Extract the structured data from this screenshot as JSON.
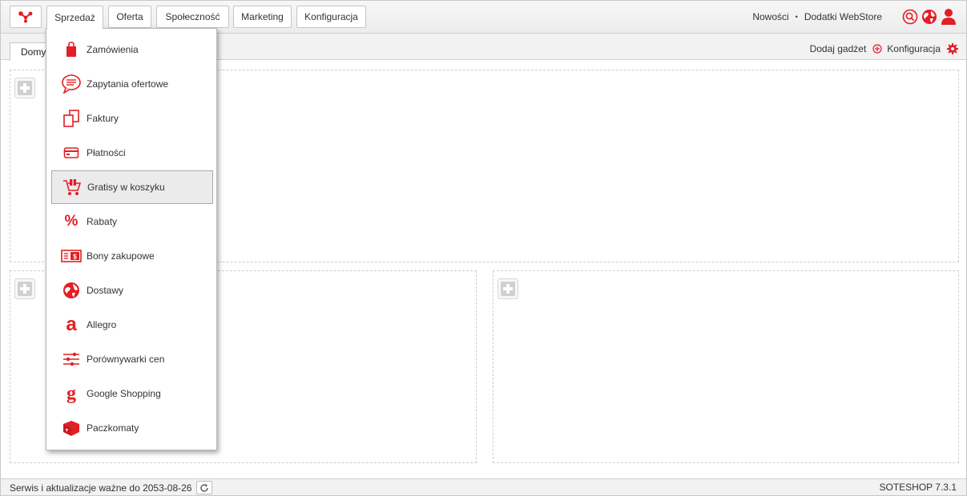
{
  "accent_color": "#e31e24",
  "topbar": {
    "logo_icon": "network-logo-icon",
    "tabs": [
      {
        "label": "Sprzedaż",
        "active": true
      },
      {
        "label": "Oferta"
      },
      {
        "label": "Społeczność"
      },
      {
        "label": "Marketing"
      },
      {
        "label": "Konfiguracja"
      }
    ],
    "links": {
      "news": "Nowości",
      "separator": "•",
      "webstore": "Dodatki WebStore"
    },
    "icons": [
      "search-icon",
      "globe-icon",
      "user-icon"
    ]
  },
  "subbar": {
    "home_tab": "Domyślny",
    "add_gadget": "Dodaj gadżet",
    "config": "Konfiguracja"
  },
  "menu": {
    "items": [
      {
        "label": "Zamówienia",
        "icon": "shopping-bag-icon"
      },
      {
        "label": "Zapytania ofertowe",
        "icon": "speech-bubble-icon"
      },
      {
        "label": "Faktury",
        "icon": "documents-icon"
      },
      {
        "label": "Płatności",
        "icon": "credit-card-icon"
      },
      {
        "label": "Gratisy w koszyku",
        "icon": "gift-cart-icon",
        "highlighted": true
      },
      {
        "label": "Rabaty",
        "icon": "percent-icon"
      },
      {
        "label": "Bony zakupowe",
        "icon": "voucher-icon"
      },
      {
        "label": "Dostawy",
        "icon": "globe-delivery-icon"
      },
      {
        "label": "Allegro",
        "icon": "allegro-icon"
      },
      {
        "label": "Porównywarki cen",
        "icon": "sliders-icon"
      },
      {
        "label": "Google Shopping",
        "icon": "google-g-icon"
      },
      {
        "label": "Paczkomaty",
        "icon": "parcel-box-icon"
      }
    ]
  },
  "footer": {
    "service": "Serwis i aktualizacje ważne do 2053-08-26",
    "version": "SOTESHOP 7.3.1"
  }
}
